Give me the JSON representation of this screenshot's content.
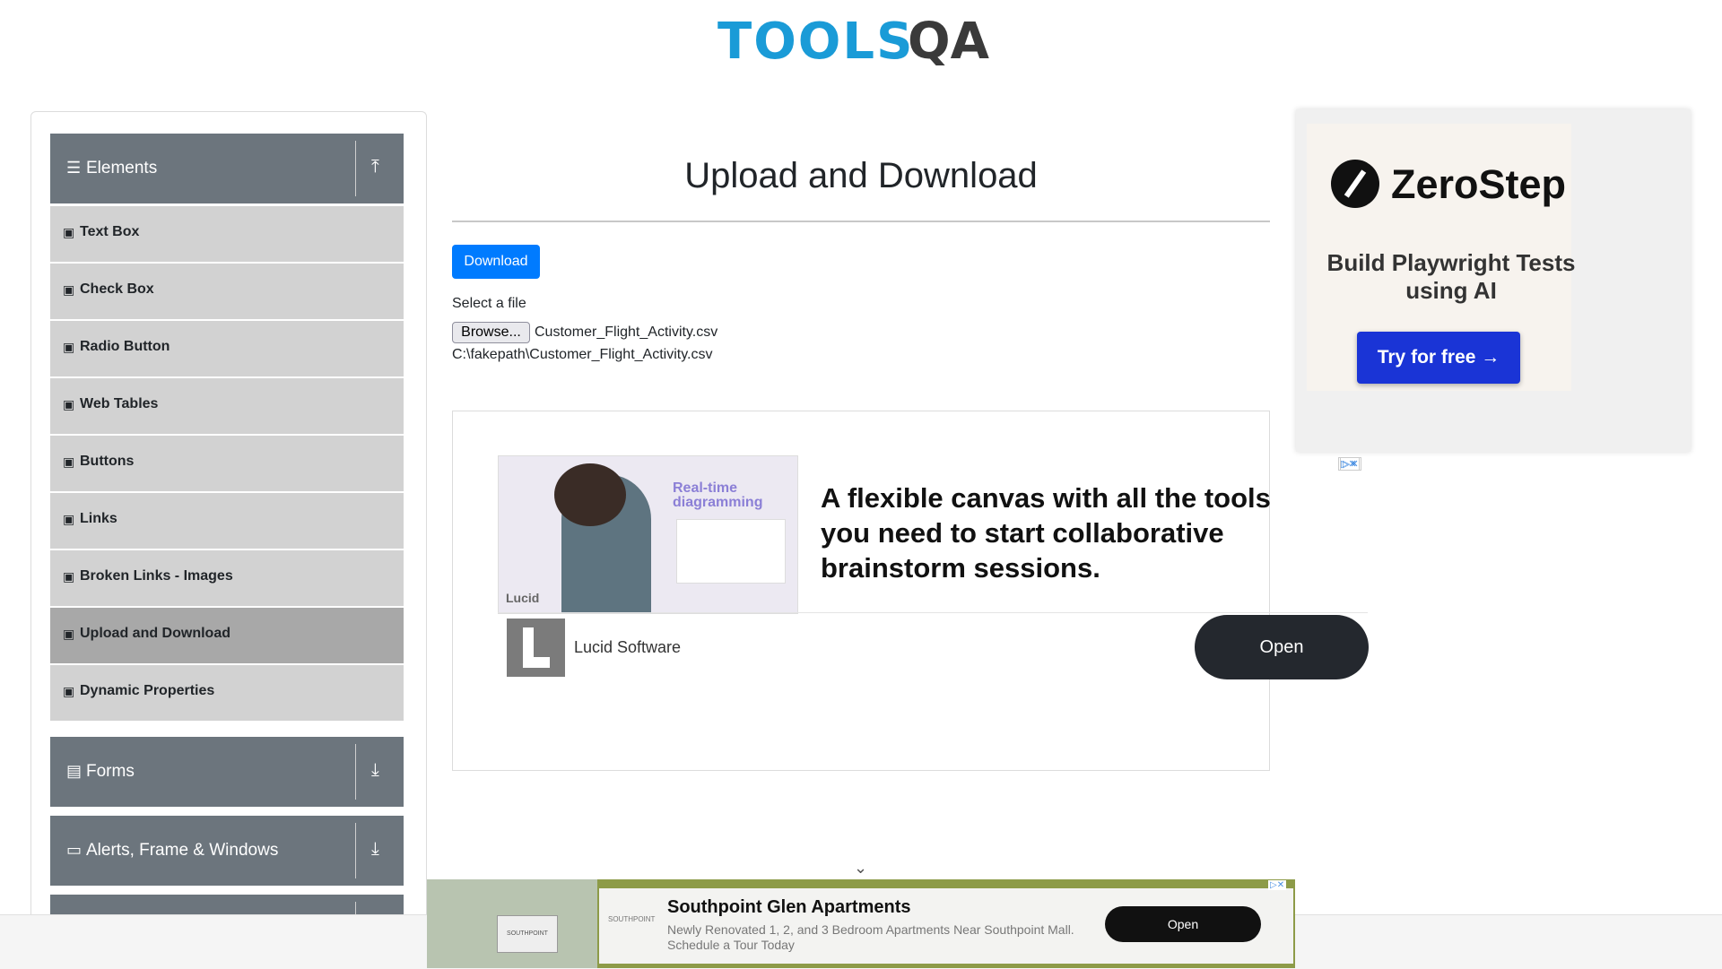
{
  "header": {
    "logo_left": "TOOLS",
    "logo_right": "QA"
  },
  "sidebar": {
    "groups": [
      {
        "icon": "☰",
        "label": "Elements",
        "toggle": "⤒"
      },
      {
        "icon": "▤",
        "label": "Forms",
        "toggle": "⤓"
      },
      {
        "icon": "▭",
        "label": "Alerts, Frame & Windows",
        "toggle": "⤓"
      }
    ],
    "items": [
      {
        "label": "Text Box"
      },
      {
        "label": "Check Box"
      },
      {
        "label": "Radio Button"
      },
      {
        "label": "Web Tables"
      },
      {
        "label": "Buttons"
      },
      {
        "label": "Links"
      },
      {
        "label": "Broken Links - Images"
      },
      {
        "label": "Upload and Download"
      },
      {
        "label": "Dynamic Properties"
      }
    ],
    "item_icon": "▣"
  },
  "main": {
    "title": "Upload and Download",
    "download_label": "Download",
    "select_label": "Select a file",
    "browse_label": "Browse...",
    "file_name": "Customer_Flight_Activity.csv",
    "uploaded_path": "C:\\fakepath\\Customer_Flight_Activity.csv"
  },
  "ad_center": {
    "image_text": "Real-time diagramming",
    "image_brand": "Lucid",
    "headline": "A flexible canvas with all the tools you need to start collaborative brainstorm sessions.",
    "brand_name": "Lucid Software",
    "open_label": "Open",
    "adchoice": "▷✕"
  },
  "ad_side": {
    "brand": "ZeroStep",
    "subtitle": "Build Playwright Tests using AI",
    "cta": "Try for free →"
  },
  "ad_bottom": {
    "title": "Southpoint Glen Apartments",
    "description": "Newly Renovated 1, 2, and 3 Bedroom Apartments Near Southpoint Mall. Schedule a Tour Today",
    "open_label": "Open",
    "sign_text": "SOUTHPOINT",
    "logo_text": "SOUTHPOINT",
    "adchoice": "▷✕"
  },
  "scroll_chevron": "⌄",
  "colors": {
    "accent": "#007bff",
    "sidebar_header": "#6c757d",
    "logo_blue": "#1a9bd7"
  }
}
